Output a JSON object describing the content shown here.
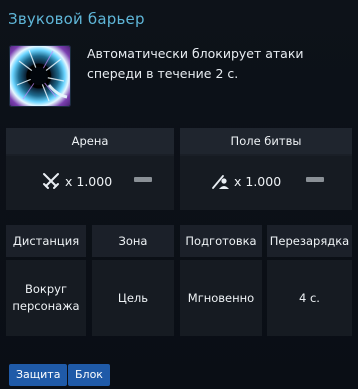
{
  "skill": {
    "name": "Звуковой барьер",
    "icon": "sonic-barrier-skill-icon",
    "description": "Автоматически блокирует атаки спереди в течение 2 с."
  },
  "modes": [
    {
      "label": "Арена",
      "icon": "crossed-swords-icon",
      "multiplier": "x 1.000"
    },
    {
      "label": "Поле битвы",
      "icon": "battlefield-icon",
      "multiplier": "x 1.000"
    }
  ],
  "stats": [
    {
      "label": "Дистанция",
      "value_line1": "Вокруг",
      "value_line2": "персонажа"
    },
    {
      "label": "Зона",
      "value_line1": "Цель",
      "value_line2": ""
    },
    {
      "label": "Подготовка",
      "value_line1": "Мгновенно",
      "value_line2": ""
    },
    {
      "label": "Перезарядка",
      "value_line1": "4 с.",
      "value_line2": ""
    }
  ],
  "tags": [
    "Защита",
    "Блок"
  ],
  "colors": {
    "title": "#5fb6d8",
    "tag_bg": "#1f5aa8",
    "panel_bg": "#0a0e15"
  }
}
